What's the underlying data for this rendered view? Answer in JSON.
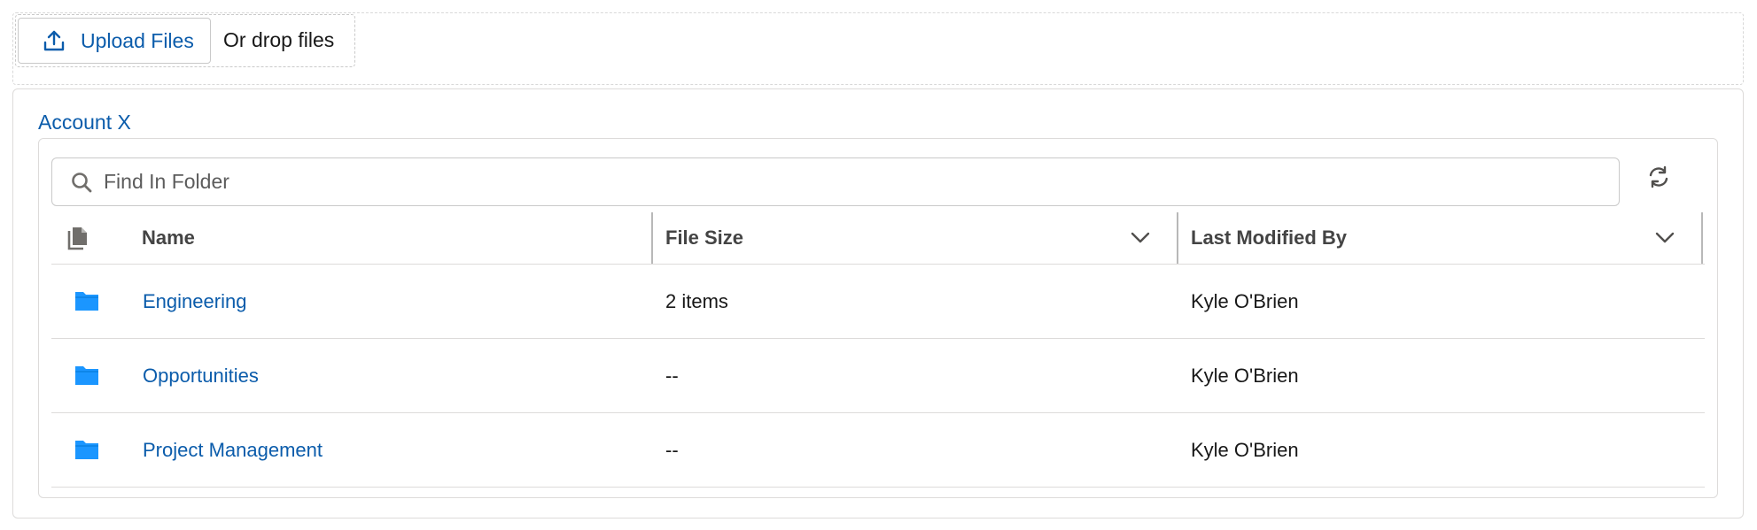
{
  "upload": {
    "button_label": "Upload Files",
    "drop_label": "Or drop files"
  },
  "breadcrumb": {
    "current": "Account X"
  },
  "search": {
    "placeholder": "Find In Folder",
    "value": ""
  },
  "table": {
    "columns": {
      "name": "Name",
      "file_size": "File Size",
      "last_modified_by": "Last Modified By"
    },
    "rows": [
      {
        "name": "Engineering",
        "file_size": "2 items",
        "last_modified_by": "Kyle O'Brien"
      },
      {
        "name": "Opportunities",
        "file_size": "--",
        "last_modified_by": "Kyle O'Brien"
      },
      {
        "name": "Project Management",
        "file_size": "--",
        "last_modified_by": "Kyle O'Brien"
      }
    ]
  },
  "icons": {
    "upload": "upload-icon",
    "search": "search-icon",
    "refresh": "refresh-icon",
    "files_header": "files-icon",
    "folder": "folder-icon",
    "chevron": "chevron-down-icon"
  },
  "colors": {
    "link": "#0b5cab",
    "folder": "#1b96ff",
    "border": "#dddbda"
  }
}
